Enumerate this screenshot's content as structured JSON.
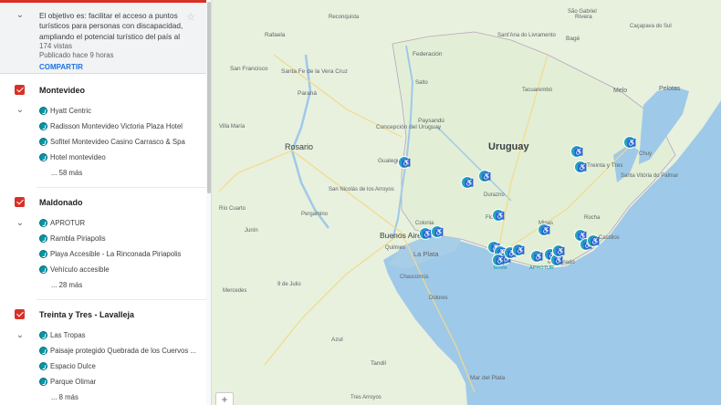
{
  "description": {
    "text": "El objetivo es: facilitar el acceso a puntos turísticos para personas con discapacidad, ampliando el potencial turístico del país al",
    "views": "174 vistas",
    "published": "Publicado hace 9 horas",
    "share": "COMPARTIR"
  },
  "layers": [
    {
      "title": "Montevideo",
      "items": [
        "Hyatt Centric",
        "Radisson Montevideo Victoria Plaza Hotel",
        "Sofitel Montevideo Casino Carrasco & Spa",
        "Hotel montevideo"
      ],
      "more": "... 58 más"
    },
    {
      "title": "Maldonado",
      "items": [
        "APROTUR",
        "Rambla Piriapolis",
        "Playa Accesible - La Rinconada Piriapolis",
        "Vehículo accesible"
      ],
      "more": "... 28 más"
    },
    {
      "title": "Treinta y Tres - Lavalleja",
      "items": [
        "Las Tropas",
        "Paisaje protegido Quebrada de los Cuervos ...",
        "Espacio Dulce",
        "Parque Olimar"
      ],
      "more": "... 8 más"
    }
  ],
  "map": {
    "labels": {
      "uruguay": "Uruguay",
      "rosario": "Rosario",
      "buenos_aires": "Buenos Aires",
      "la_plata": "La Plata",
      "quilmes": "Quilmes",
      "santa_fe": "Santa Fe de la Vera Cruz",
      "parana": "Paraná",
      "concepcion": "Concepción del Uruguay",
      "paysandu": "Paysandú",
      "melo": "Melo",
      "treinta_tres": "Treinta y Tres",
      "santa_vitoria": "Santa Vitória do Palmar",
      "pelotas": "Pelotas",
      "mar_del_plata": "Mar del Plata",
      "rivera": "Rivera",
      "gualeguay": "Gualeguay",
      "federacion": "Federación",
      "san_francisco": "San Francisco",
      "rafaela": "Rafaela",
      "maldonado": "Maldonado",
      "aprotur": "APROTUR",
      "movie": "Movie",
      "san_gabriel": "São Gabriel",
      "cacapava": "Caçapava do Sul",
      "livramento": "Sant'Ana do Livramento",
      "bage": "Bagé",
      "mercedes": "Mercedes",
      "azul": "Azul",
      "tandil": "Tandil",
      "dolores": "Dolores",
      "chascomus": "Chascomús",
      "nueve_julio": "9 de Julio",
      "tres_arroyos": "Tres Arroyos",
      "pergamino": "Pergamino",
      "junin": "Junín",
      "san_nicolas": "San Nicolás de los Arroyos",
      "villa_maria": "Villa María",
      "rio_cuarto": "Río Cuarto",
      "reconquista": "Reconquista",
      "rocha": "Rocha",
      "chuy": "Chuy",
      "florida": "Florida",
      "durazno": "Durazno",
      "tacuarembo": "Tacuarembó",
      "salto": "Salto",
      "colonia": "Colonia",
      "minas": "Minas",
      "castillos": "Castillos"
    },
    "zoom_button": "+"
  },
  "colors": {
    "accent": "#d93025",
    "pin": "#0097a7",
    "sea": "#9fc9e8",
    "land": "#e8f1de",
    "share": "#1a73e8"
  }
}
